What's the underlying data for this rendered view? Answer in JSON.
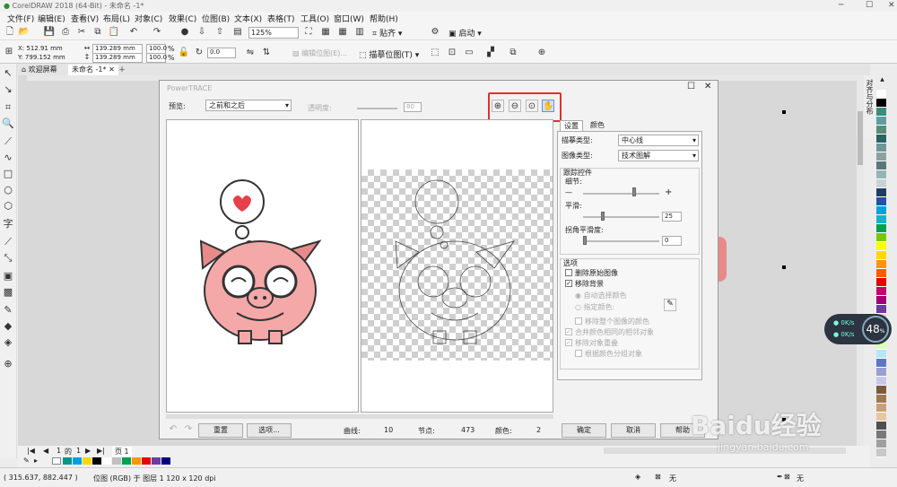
{
  "app": {
    "title": "CorelDRAW 2018 (64-Bit) - 未命名 -1*"
  },
  "menu": [
    "文件(F)",
    "编辑(E)",
    "查看(V)",
    "布局(L)",
    "对象(C)",
    "效果(C)",
    "位图(B)",
    "文本(X)",
    "表格(T)",
    "工具(O)",
    "窗口(W)",
    "帮助(H)"
  ],
  "toolbar": {
    "zoom": "125%",
    "snap_label": "贴齐",
    "launch_label": "启动"
  },
  "propbar": {
    "x": "X: 512.91 mm",
    "y": "Y: 799.152 mm",
    "w": "139.289 mm",
    "h": "139.289 mm",
    "sx": "100.0",
    "sy": "100.0",
    "angle": "0.0",
    "edit_bitmap": "编辑位图(E)...",
    "trace_bitmap": "描摹位图(T)"
  },
  "doc_tabs": {
    "welcome": "欢迎屏幕",
    "doc": "未命名 -1*"
  },
  "dialog": {
    "title": "PowerTRACE",
    "preview_label": "预览:",
    "preview_value": "之前和之后",
    "transparency_label": "透明度:",
    "transparency_value": "80",
    "tabs": [
      "设置",
      "颜色"
    ],
    "trace_type_label": "描摹类型:",
    "trace_type_value": "中心线",
    "image_type_label": "图像类型:",
    "image_type_value": "技术图解",
    "trace_controls": "跟踪控件",
    "detail_label": "细节:",
    "smooth_label": "平滑:",
    "smooth_value": "25",
    "corner_label": "拐角平滑度:",
    "corner_value": "0",
    "options_label": "选项",
    "opt_delete": "删除原始图像",
    "opt_remove_bg": "移除背景",
    "opt_auto_color": "自动选择颜色",
    "opt_specify_color": "指定颜色:",
    "opt_remove_all": "移除整个图像的颜色",
    "opt_merge": "合并颜色相同的相邻对象",
    "opt_remove_overlap": "移除对象重叠",
    "opt_group": "根据颜色分组对象",
    "reset": "重置",
    "options_btn": "选项...",
    "curves_label": "曲线:",
    "curves_value": "10",
    "nodes_label": "节点:",
    "nodes_value": "473",
    "colors_label": "颜色:",
    "colors_value": "2",
    "ok": "确定",
    "cancel": "取消",
    "help": "帮助"
  },
  "pages": {
    "current": "1",
    "of": "的",
    "total": "1",
    "page_tab": "页 1"
  },
  "status": {
    "coords": "( 315.637, 882.447 )",
    "info": "位图 (RGB) 于 图层 1 120 x 120 dpi",
    "fill_none": "无",
    "outline_none": "无"
  },
  "side_panel": "对齐与分布",
  "net": {
    "percent": "48",
    "unit": "%",
    "up": "0",
    "down": "0",
    "rate_unit": "K/s"
  },
  "watermark": {
    "brand": "Baidu经验",
    "url": "jingyan.baidu.com"
  },
  "palette": [
    "#ffffff",
    "#000000",
    "#3c8c7c",
    "#5aa0a0",
    "#5a8c78",
    "#2a6460",
    "#6e9696",
    "#8ca0a0",
    "#5a7878",
    "#96b4b4",
    "#c8d2d2",
    "#1e3c64",
    "#2850a0",
    "#00a0e0",
    "#14b4c8",
    "#00a050",
    "#78c800",
    "#ffff00",
    "#ffd700",
    "#ff9600",
    "#ff5a00",
    "#e60000",
    "#c8006e",
    "#a00078",
    "#6e3ca0",
    "#ffc8c8",
    "#ffdca0",
    "#fff0b4",
    "#dcffb4",
    "#b4e6ff",
    "#5a78c8",
    "#96a0d2",
    "#c8c8e6",
    "#785a3c",
    "#a07850",
    "#c8a078",
    "#e6c8a0",
    "#505050",
    "#787878",
    "#a0a0a0",
    "#c8c8c8"
  ],
  "bottom_swatches": [
    "#009688",
    "#00a0e0",
    "#ffd700",
    "#000000",
    "#ffffff",
    "#c0c0c0",
    "#00a050",
    "#ff9600",
    "#e60000",
    "#6e3ca0",
    "#000080"
  ]
}
